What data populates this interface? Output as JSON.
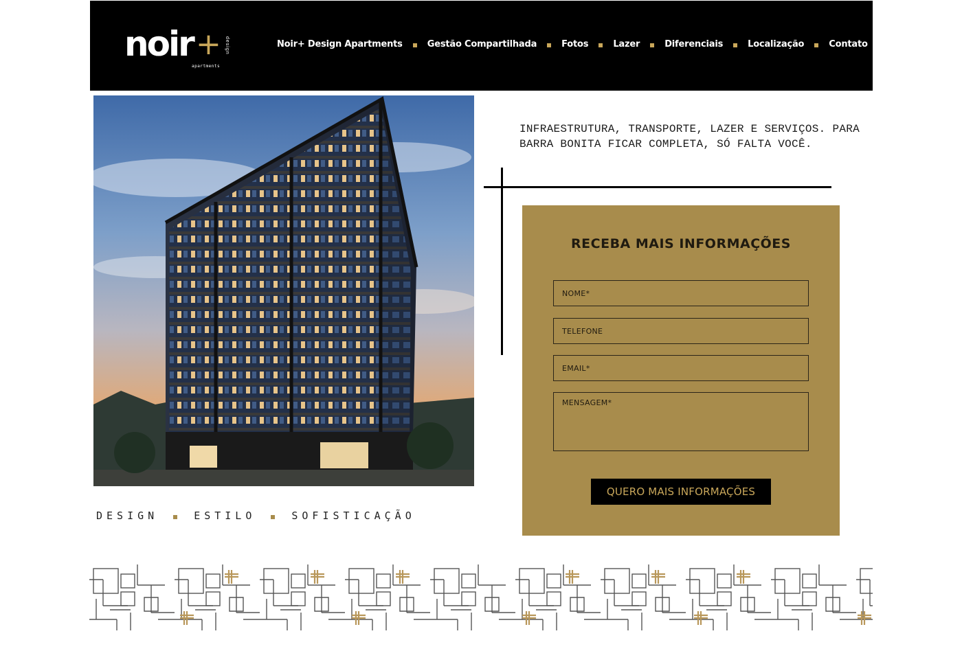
{
  "header": {
    "logo": {
      "word": "noir",
      "plus": "+",
      "tagline": "design",
      "sub": "apartments"
    },
    "nav": [
      {
        "label": "Noir+ Design Apartments"
      },
      {
        "label": "Gestão Compartilhada"
      },
      {
        "label": "Fotos"
      },
      {
        "label": "Lazer"
      },
      {
        "label": "Diferenciais"
      },
      {
        "label": "Localização"
      },
      {
        "label": "Contato"
      }
    ]
  },
  "hero": {
    "photo_icon": "building-rendering",
    "tagline": [
      "DESIGN",
      "ESTILO",
      "SOFISTICAÇÃO"
    ]
  },
  "intro": {
    "text": "INFRAESTRUTURA, TRANSPORTE, LAZER E SERVIÇOS. PARA BARRA BONITA FICAR COMPLETA, SÓ FALTA VOCÊ."
  },
  "form": {
    "title": "RECEBA MAIS INFORMAÇÕES",
    "fields": {
      "nome": {
        "value": "",
        "placeholder": "NOME*"
      },
      "telefone": {
        "value": "",
        "placeholder": "TELEFONE"
      },
      "email": {
        "value": "",
        "placeholder": "EMAIL*"
      },
      "mensagem": {
        "value": "",
        "placeholder": "MENSAGEM*"
      }
    },
    "submit_label": "QUERO MAIS INFORMAÇÕES"
  },
  "colors": {
    "header_bg": "#000000",
    "accent_gold": "#c9a75a",
    "panel_gold": "#a88c4c",
    "text_dark": "#1a1a1a"
  },
  "decor": {
    "pattern_icon": "geometric-maze-pattern"
  }
}
